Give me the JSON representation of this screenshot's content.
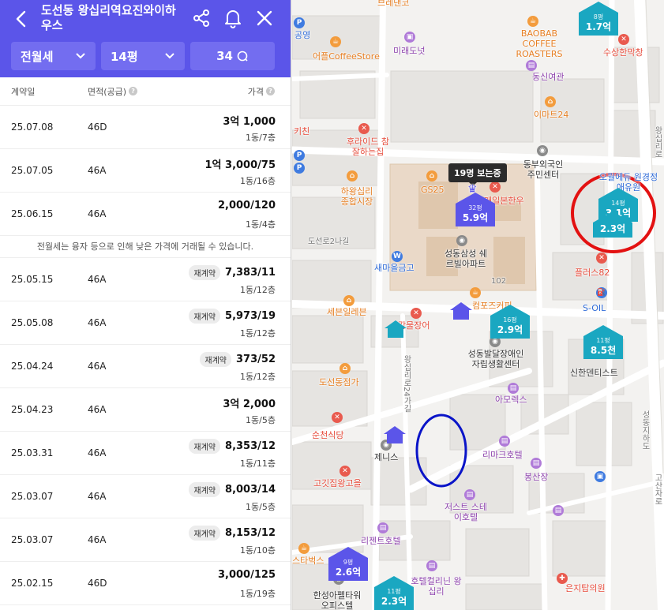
{
  "header": {
    "title": "도선동 왕십리역요진와이하우스",
    "filter_type": "전월세",
    "filter_size": "14평",
    "count": "34"
  },
  "table": {
    "col_date": "계약일",
    "col_area": "면적(공급)",
    "col_price": "가격",
    "notice": "전월세는 융자 등으로 인해 낮은 가격에 거래될 수 있습니다.",
    "renew_badge": "재계약",
    "rows_top": [
      {
        "date": "25.07.08",
        "area": "46D",
        "price": "3억 1,000",
        "floor": "1동/7층"
      },
      {
        "date": "25.07.05",
        "area": "46A",
        "price": "1억 3,000/75",
        "floor": "1동/16층"
      },
      {
        "date": "25.06.15",
        "area": "46A",
        "price": "2,000/120",
        "floor": "1동/4층"
      }
    ],
    "rows": [
      {
        "date": "25.05.15",
        "area": "46A",
        "renew": true,
        "price": "7,383/11",
        "floor": "1동/12층"
      },
      {
        "date": "25.05.08",
        "area": "46A",
        "renew": true,
        "price": "5,973/19",
        "floor": "1동/12층"
      },
      {
        "date": "25.04.24",
        "area": "46A",
        "renew": true,
        "price": "373/52",
        "floor": "1동/12층"
      },
      {
        "date": "25.04.23",
        "area": "46A",
        "renew": false,
        "price": "3억 2,000",
        "floor": "1동/5층"
      },
      {
        "date": "25.03.31",
        "area": "46A",
        "renew": true,
        "price": "8,353/12",
        "floor": "1동/11층"
      },
      {
        "date": "25.03.07",
        "area": "46A",
        "renew": true,
        "price": "8,003/14",
        "floor": "1동/5층"
      },
      {
        "date": "25.03.07",
        "area": "46A",
        "renew": true,
        "price": "8,153/12",
        "floor": "1동/10층"
      },
      {
        "date": "25.02.15",
        "area": "46D",
        "renew": false,
        "price": "3,000/125",
        "floor": "1동/19층"
      }
    ]
  },
  "map": {
    "tooltip": "19명 보는중",
    "labels": {
      "brand_top": "브레댄코",
      "baobab": "BAOBAB COFFEE ROASTERS",
      "gongyeong": "공영",
      "coffeestore": "어플CoffeeStore",
      "miraedonut": "미래도넛",
      "dongsin": "동신여관",
      "susang": "수상한막창",
      "emart24": "이마트24",
      "kichin": "키친",
      "huraideu": "후라이드 참잘하는집",
      "dongbu": "동부외국인 주민센터",
      "hawangsimni": "하왕십리 종합시장",
      "gs25": "GS25",
      "maeilbon": "매일본한우",
      "dosungil": "도선로2나길",
      "saemaeul": "새마을금고",
      "seongdong": "성동삼성 쉐르빌아파트",
      "num102": "102",
      "plus82": "플러스82",
      "soil": "S-OIL",
      "compose": "컴포즈커피",
      "sebon": "세븐일레븐",
      "gamuljang": "감물장어",
      "seongdongdis": "성동발달장애인 자립생활센터",
      "sinhan": "신한덴티스트",
      "road24": "왕십리로24가길",
      "doseon": "도선동점가",
      "amorex": "아모렉스",
      "suncheon": "순천식당",
      "jenis": "제니스",
      "rimark": "리마크호텔",
      "bongsan": "봉산장",
      "gogitjip": "고깃집왕고을",
      "jeoseuteu": "저스트 스테이호텔",
      "regent": "리젠트호텔",
      "starbucks": "스타벅스",
      "hotelcallin": "호텔컬리닌 왕십리",
      "hansung": "한성아펠타워 오피스텔",
      "seongdongji": "성동지하도",
      "wangsimni_side": "왕십리로",
      "hak_side": "고산자로",
      "eunji": "은지탑의원",
      "yeju": "오월에듀 원경정애유원"
    },
    "markers": [
      {
        "pm": "8평",
        "price": "1.7억",
        "variant": "teal"
      },
      {
        "pm": "14평",
        "price": "3.1억",
        "variant": "teal"
      },
      {
        "pm": "",
        "price": "2.3억",
        "variant": "teal"
      },
      {
        "pm": "32평",
        "price": "5.9억",
        "variant": "violet"
      },
      {
        "pm": "16평",
        "price": "2.9억",
        "variant": "teal"
      },
      {
        "pm": "11평",
        "price": "8.5천",
        "variant": "teal"
      },
      {
        "pm": "9평",
        "price": "2.6억",
        "variant": "violet"
      },
      {
        "pm": "11평",
        "price": "2.3억",
        "variant": "teal"
      }
    ]
  }
}
